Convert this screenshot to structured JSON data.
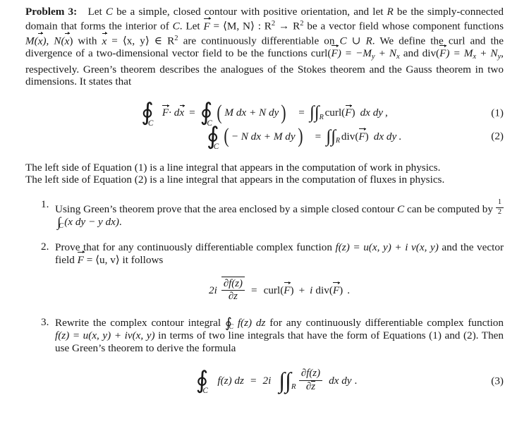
{
  "document": {
    "problem_label": "Problem 3:",
    "intro": {
      "s1": "Let ",
      "C": "C",
      "s2": " be a simple, closed contour with positive orientation, and let ",
      "R": "R",
      "s3": " be the simply-connected domain that forms the interior of ",
      "C2": "C",
      "s4": ". Let ",
      "F": "F",
      "s5": " = ",
      "MN": "⟨M, N⟩",
      "s6": " : ",
      "R2a": "R",
      "exp2a": "2",
      "arrow": " → ",
      "R2b": "R",
      "exp2b": "2",
      "s7": " be a vector field whose component functions ",
      "Mx": "M(",
      "xvec1": "x",
      "Nx": "), N(",
      "xvec2": "x",
      "s8": ") with ",
      "xvec3": "x",
      "s9": " = ",
      "xy": "⟨x, y⟩",
      "in": " ∈ ",
      "R2c": "R",
      "exp2c": "2",
      "s10": " are continuously differentiable on ",
      "CuR": "C ∪ R",
      "s11": ". We define the curl and the divergence of a two-dimensional vector field to be the functions ",
      "curl_lhs": "curl(",
      "F2": "F",
      "curl_eq": ") = −M",
      "sub_y1": "y",
      "plus1": " + N",
      "sub_x1": "x",
      "and": " and div(",
      "F3": "F",
      "div_eq": ") = M",
      "sub_x2": "x",
      "plus2": " + N",
      "sub_y2": "y",
      "s12": ", respectively. Green’s theorem describes the analogues of the Stokes theorem and the Gauss theorem in two dimensions. It states that"
    },
    "equations": [
      {
        "number": "(1)",
        "id": "equation-1",
        "lhs_vec": "F",
        "lhs_dot": " · d",
        "lhs_xvec": "x",
        "equals1": "=",
        "integrand": "M dx + N dy",
        "equals2": "=",
        "rhs_op": "curl(",
        "rhs_vec": "F",
        "rhs_close": ")",
        "rhs_diff": "dx dy",
        "punct": ",",
        "contour_lim": "C",
        "region_lim": "R"
      },
      {
        "number": "(2)",
        "id": "equation-2",
        "integrand": "− N dx + M dy",
        "equals2": "=",
        "rhs_op": "div(",
        "rhs_vec": "F",
        "rhs_close": ")",
        "rhs_diff": "dx dy",
        "punct": ".",
        "contour_lim": "C",
        "region_lim": "R"
      }
    ],
    "middle_paragraph": {
      "line1": "The left side of Equation (1) is a line integral that appears in the computation of work in physics.",
      "line2": "The left side of Equation (2) is a line integral that appears in the computation of fluxes in physics."
    },
    "problems": [
      {
        "marker": "1.",
        "id": "problem-item-1",
        "text_a": "Using Green’s theorem prove that the area enclosed by a simple closed contour ",
        "math_C": "C",
        "text_b": " can be computed by ",
        "frac_num": "1",
        "frac_den": "2",
        "int_lim": "C",
        "integrand": "(x dy − y dx)",
        "text_c": "."
      },
      {
        "marker": "2.",
        "id": "problem-item-2",
        "text_a": "Prove that for any continuously differentiable complex function ",
        "math_f": "f(z) = u(x, y) + i v(x, y)",
        "text_b": " and the vector field ",
        "math_F": "F",
        "math_F_eq": " = ",
        "math_uv": "⟨u, v⟩",
        "text_c": " it follows",
        "display": {
          "coef": "2i",
          "num": "∂f(z)",
          "den": "∂z",
          "equals": "=",
          "curl_op": "curl(",
          "curl_vec": "F",
          "curl_close": ")",
          "plus": "+",
          "i": "i",
          "div_op": "div(",
          "div_vec": "F",
          "div_close": ")",
          "punct": "."
        }
      },
      {
        "marker": "3.",
        "id": "problem-item-3",
        "text_a": "Rewrite the complex contour integral ",
        "int_lim": "C",
        "math_fz": "f(z) dz",
        "text_b": " for any continuously differentiable complex function ",
        "math_f": "f(z) = u(x, y) + iv(x, y)",
        "text_c": " in terms of two line integrals that have the form of Equations (1) and (2). Then use Green’s theorem to derive the formula"
      }
    ],
    "final_equation": {
      "number": "(3)",
      "id": "equation-3",
      "contour_lim": "C",
      "lhs": "f(z) dz",
      "equals": "=",
      "coef": "2i",
      "region_lim": "R",
      "num": "∂f(z)",
      "den_partial": "∂",
      "den_zbar": "z",
      "diff": "dx dy",
      "punct": "."
    }
  }
}
